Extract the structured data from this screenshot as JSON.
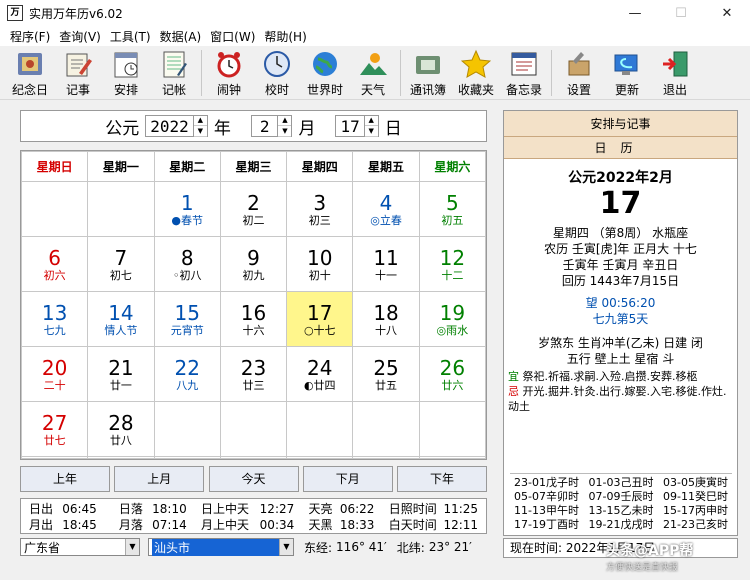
{
  "window": {
    "title": "实用万年历v6.02",
    "icon": "万",
    "minimize": "—",
    "maximize": "☐",
    "close": "✕"
  },
  "menu": [
    "程序(F)",
    "查询(V)",
    "工具(T)",
    "数据(A)",
    "窗口(W)",
    "帮助(H)"
  ],
  "toolbar": [
    {
      "label": "纪念日",
      "icon": "film-icon"
    },
    {
      "label": "记事",
      "icon": "notepad-pen-icon"
    },
    {
      "label": "安排",
      "icon": "calendar-schedule-icon"
    },
    {
      "label": "记帐",
      "icon": "ledger-icon"
    },
    {
      "label": "闹钟",
      "icon": "alarm-clock-icon"
    },
    {
      "label": "校时",
      "icon": "clock-icon"
    },
    {
      "label": "世界时",
      "icon": "globe-icon"
    },
    {
      "label": "天气",
      "icon": "weather-icon"
    },
    {
      "label": "通讯簿",
      "icon": "address-book-icon"
    },
    {
      "label": "收藏夹",
      "icon": "star-icon"
    },
    {
      "label": "备忘录",
      "icon": "memo-icon"
    },
    {
      "label": "设置",
      "icon": "tools-icon"
    },
    {
      "label": "更新",
      "icon": "update-icon"
    },
    {
      "label": "退出",
      "icon": "exit-door-icon"
    }
  ],
  "datebar": {
    "era": "公元",
    "year": "2022",
    "year_unit": "年",
    "month": "2",
    "month_unit": "月",
    "day": "17",
    "day_unit": "日"
  },
  "weekdays": [
    "星期日",
    "星期一",
    "星期二",
    "星期三",
    "星期四",
    "星期五",
    "星期六"
  ],
  "weeks": [
    [
      {
        "d": "",
        "l": ""
      },
      {
        "d": "",
        "l": ""
      },
      {
        "d": "1",
        "l": "●春节"
      },
      {
        "d": "2",
        "l": "初二"
      },
      {
        "d": "3",
        "l": "初三"
      },
      {
        "d": "4",
        "l": "◎立春"
      },
      {
        "d": "5",
        "l": "初五"
      }
    ],
    [
      {
        "d": "6",
        "l": "初六"
      },
      {
        "d": "7",
        "l": "初七"
      },
      {
        "d": "8",
        "l": "◦初八"
      },
      {
        "d": "9",
        "l": "初九"
      },
      {
        "d": "10",
        "l": "初十"
      },
      {
        "d": "11",
        "l": "十一"
      },
      {
        "d": "12",
        "l": "十二"
      }
    ],
    [
      {
        "d": "13",
        "l": "七九"
      },
      {
        "d": "14",
        "l": "情人节"
      },
      {
        "d": "15",
        "l": "元宵节"
      },
      {
        "d": "16",
        "l": "十六"
      },
      {
        "d": "17",
        "l": "○十七"
      },
      {
        "d": "18",
        "l": "十八"
      },
      {
        "d": "19",
        "l": "◎雨水"
      }
    ],
    [
      {
        "d": "20",
        "l": "二十"
      },
      {
        "d": "21",
        "l": "廿一"
      },
      {
        "d": "22",
        "l": "八九"
      },
      {
        "d": "23",
        "l": "廿三"
      },
      {
        "d": "24",
        "l": "◐廿四"
      },
      {
        "d": "25",
        "l": "廿五"
      },
      {
        "d": "26",
        "l": "廿六"
      }
    ],
    [
      {
        "d": "27",
        "l": "廿七"
      },
      {
        "d": "28",
        "l": "廿八"
      },
      {
        "d": "",
        "l": ""
      },
      {
        "d": "",
        "l": ""
      },
      {
        "d": "",
        "l": ""
      },
      {
        "d": "",
        "l": ""
      },
      {
        "d": "",
        "l": ""
      }
    ],
    [
      {
        "d": "",
        "l": ""
      },
      {
        "d": "",
        "l": ""
      },
      {
        "d": "",
        "l": ""
      },
      {
        "d": "",
        "l": ""
      },
      {
        "d": "",
        "l": ""
      },
      {
        "d": "",
        "l": ""
      },
      {
        "d": "",
        "l": ""
      }
    ]
  ],
  "selected_day": "17",
  "nav": [
    "上年",
    "上月",
    "今天",
    "下月",
    "下年"
  ],
  "times": {
    "row1": [
      "日出",
      "06:45",
      "日落",
      "18:10",
      "日上中天",
      "12:27",
      "天亮",
      "06:22",
      "日照时间",
      "11:25"
    ],
    "row2": [
      "月出",
      "18:45",
      "月落",
      "07:14",
      "月上中天",
      "00:34",
      "天黑",
      "18:33",
      "白天时间",
      "12:11"
    ]
  },
  "location": {
    "province": "广东省",
    "city": "汕头市",
    "lon_label": "东经:",
    "lon": "116° 41′",
    "lat_label": "北纬:",
    "lat": "23° 21′"
  },
  "info": {
    "header": "安排与记事",
    "subheader": "日历",
    "date_line": "公元2022年2月",
    "day": "17",
    "week_line": "星期四 （第8周） 水瓶座",
    "lunar_line": "农历 壬寅[虎]年 正月大 十七",
    "ganzhi_line": "壬寅年 壬寅月 辛丑日",
    "hijri_line": "回历 1443年7月15日",
    "moon_line": "望 00:56:20",
    "nine_line": "七九第5天",
    "sui_line": "岁煞东 生肖冲羊(乙未) 日建 闭",
    "wuxing_line": "五行 壁上土  星宿 斗",
    "yi_label": "宜",
    "yi_text": "祭祀.祈福.求嗣.入殓.启攒.安葬.移柩",
    "ji_label": "忌",
    "ji_text": "开光.掘井.针灸.出行.嫁娶.入宅.移徙.作灶.动土",
    "hours": [
      [
        "23-01戊子时",
        "01-03己丑时",
        "03-05庚寅时"
      ],
      [
        "05-07辛卯时",
        "07-09壬辰时",
        "09-11癸巳时"
      ],
      [
        "11-13甲午时",
        "13-15乙未时",
        "15-17丙申时"
      ],
      [
        "17-19丁酉时",
        "19-21戊戌时",
        "21-23己亥时"
      ]
    ]
  },
  "status": "现在时间: 2022年2月17日",
  "watermark": {
    "text": "头条@APP帮",
    "sub": "方便快送是直快报"
  },
  "colors": {
    "red": "#d40000",
    "green": "#008000",
    "blue": "#0050b0",
    "selected_bg": "#fff68c",
    "panel_header": "#f3e1c8"
  }
}
